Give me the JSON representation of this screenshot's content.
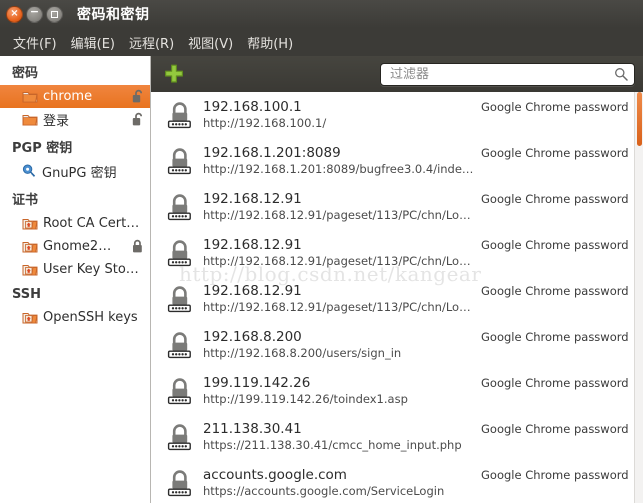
{
  "window": {
    "title": "密码和密钥",
    "controls": {
      "close": "×",
      "minimize": "−",
      "maximize": "□"
    }
  },
  "menubar": {
    "items": [
      {
        "label": "文件(F)"
      },
      {
        "label": "编辑(E)"
      },
      {
        "label": "远程(R)"
      },
      {
        "label": "视图(V)"
      },
      {
        "label": "帮助(H)"
      }
    ]
  },
  "sidebar": {
    "groups": [
      {
        "title": "密码",
        "items": [
          {
            "label": "chrome",
            "icon": "folder-icon",
            "selected": true,
            "lock": "unlocked-padlock-icon"
          },
          {
            "label": "登录",
            "icon": "folder-icon",
            "selected": false,
            "lock": "unlocked-padlock-icon"
          }
        ]
      },
      {
        "title": "PGP 密钥",
        "items": [
          {
            "label": "GnuPG 密钥",
            "icon": "key-icon",
            "selected": false,
            "lock": ""
          }
        ]
      },
      {
        "title": "证书",
        "items": [
          {
            "label": "Root CA Cert…",
            "icon": "certificate-folder-icon",
            "selected": false,
            "lock": ""
          },
          {
            "label": "Gnome2…",
            "icon": "certificate-folder-icon",
            "selected": false,
            "lock": "locked-padlock-icon"
          },
          {
            "label": "User Key Sto…",
            "icon": "certificate-folder-icon",
            "selected": false,
            "lock": ""
          }
        ]
      },
      {
        "title": "SSH",
        "items": [
          {
            "label": "OpenSSH keys",
            "icon": "certificate-folder-icon",
            "selected": false,
            "lock": ""
          }
        ]
      }
    ]
  },
  "toolbar": {
    "add_label": "+",
    "add_icon": "plus-icon",
    "search": {
      "value": "",
      "placeholder": "过滤器",
      "icon": "search-icon"
    }
  },
  "list": {
    "watermark": "http://blog.csdn.net/kangear",
    "rows": [
      {
        "title": "192.168.100.1",
        "subtitle": "http://192.168.100.1/",
        "type": "Google Chrome password",
        "icon": "password-lock-icon"
      },
      {
        "title": "192.168.1.201:8089",
        "subtitle": "http://192.168.1.201:8089/bugfree3.0.4/inde…",
        "type": "Google Chrome password",
        "icon": "password-lock-icon"
      },
      {
        "title": "192.168.12.91",
        "subtitle": "http://192.168.12.91/pageset/113/PC/chn/Lo…",
        "type": "Google Chrome password",
        "icon": "password-lock-icon"
      },
      {
        "title": "192.168.12.91",
        "subtitle": "http://192.168.12.91/pageset/113/PC/chn/Lo…",
        "type": "Google Chrome password",
        "icon": "password-lock-icon"
      },
      {
        "title": "192.168.12.91",
        "subtitle": "http://192.168.12.91/pageset/113/PC/chn/Lo…",
        "type": "Google Chrome password",
        "icon": "password-lock-icon"
      },
      {
        "title": "192.168.8.200",
        "subtitle": "http://192.168.8.200/users/sign_in",
        "type": "Google Chrome password",
        "icon": "password-lock-icon"
      },
      {
        "title": "199.119.142.26",
        "subtitle": "http://199.119.142.26/toindex1.asp",
        "type": "Google Chrome password",
        "icon": "password-lock-icon"
      },
      {
        "title": "211.138.30.41",
        "subtitle": "https://211.138.30.41/cmcc_home_input.php",
        "type": "Google Chrome password",
        "icon": "password-lock-icon"
      },
      {
        "title": "accounts.google.com",
        "subtitle": "https://accounts.google.com/ServiceLogin",
        "type": "Google Chrome password",
        "icon": "password-lock-icon"
      }
    ]
  },
  "colors": {
    "accent": "#e8731f",
    "titlebar": "#3c3b37",
    "selection": "#e8731f",
    "plus": "#8cc63e"
  }
}
